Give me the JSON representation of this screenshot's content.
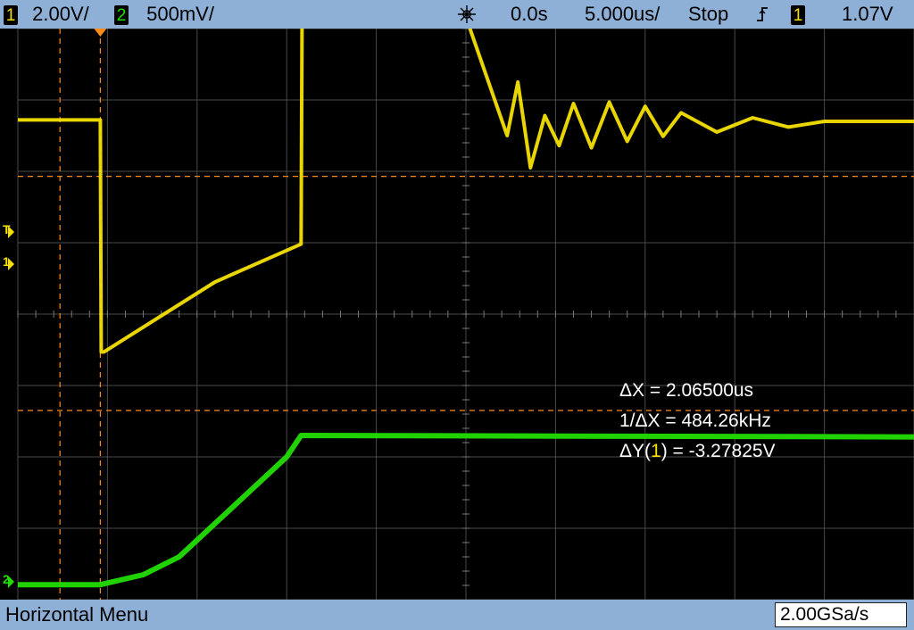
{
  "status_bar": {
    "ch1_number": "1",
    "ch1_scale": "2.00V/",
    "ch2_number": "2",
    "ch2_scale": "500mV/",
    "acq_icon": "acquisition-mode-icon",
    "time_delay": "0.0s",
    "time_scale": "5.000us/",
    "run_state": "Stop",
    "trigger_icon": "rising-edge-trigger-icon",
    "trigger_source": "1",
    "trigger_level": "1.07V"
  },
  "markers": {
    "trigger": "T",
    "ch1_ground": "1",
    "ch2_ground": "2"
  },
  "measurements": {
    "delta_x": "ΔX = 2.06500us",
    "inv_delta_x": "1/ΔX = 484.26kHz",
    "delta_y_prefix": "ΔY(",
    "delta_y_channel": "1",
    "delta_y_suffix": ") = -3.27825V"
  },
  "bottom_bar": {
    "menu_label": "Horizontal Menu",
    "sample_rate": "2.00GSa/s"
  },
  "colors": {
    "ch1": "#f5e000",
    "ch2": "#22dd00",
    "cursor": "#ff8c1a",
    "grid": "#4a4a4a",
    "bar": "#8fb0d6"
  },
  "chart_data": {
    "type": "line",
    "xlim": [
      -25,
      25
    ],
    "ylim_divisions": [
      -4,
      4
    ],
    "grid": "10x8 divisions",
    "series": [
      {
        "channel": "1",
        "units": "V",
        "scale_per_div": 2.0,
        "x": [
          -25,
          -20.4,
          -20.35,
          -20.2,
          -14,
          -9.2,
          -9.1,
          -8.9,
          1.4,
          -2.2,
          2.3,
          2.9,
          3.6,
          4.4,
          5.2,
          6.0,
          7.0,
          8.0,
          9.0,
          10.0,
          11.0,
          12.0,
          14.0,
          16.0,
          18.0,
          20.0,
          25
        ],
        "y": [
          2.72,
          2.72,
          -0.53,
          -0.53,
          0.45,
          0.98,
          6.6,
          6.62,
          5.29,
          5.75,
          2.5,
          3.25,
          2.05,
          2.78,
          2.36,
          2.95,
          2.33,
          2.97,
          2.42,
          2.91,
          2.49,
          2.82,
          2.55,
          2.75,
          2.62,
          2.7,
          2.7
        ],
        "note": ""
      },
      {
        "channel": "2",
        "units": "V",
        "scale_per_div": 0.5,
        "x": [
          -25,
          -20.4,
          -18,
          -16,
          -13,
          -10,
          -9.2,
          25
        ],
        "y": [
          -3.79,
          -3.79,
          -3.65,
          -3.4,
          -2.7,
          -2.0,
          -1.7,
          -1.72
        ]
      }
    ],
    "cursors": {
      "x1": -22.65,
      "x2": -20.4,
      "y1": 1.93,
      "y2": -1.35
    }
  }
}
